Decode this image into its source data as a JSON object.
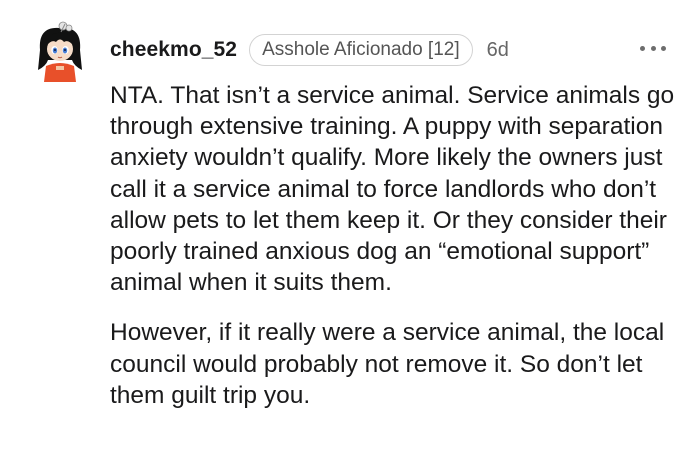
{
  "comment": {
    "username": "cheekmo_52",
    "flair": "Asshole Aficionado [12]",
    "age": "6d",
    "paragraphs": [
      "NTA. That isn’t a service animal. Service animals go through extensive training. A puppy with separation anxiety wouldn’t qualify. More likely the owners just call it a service animal to force landlords who don’t allow pets to let them keep it. Or they consider their poorly trained anxious dog an “emotional support” animal when it suits them.",
      "However, if it really were a service animal, the local council would probably not remove it. So don’t let them guilt trip you."
    ]
  },
  "icons": {
    "avatar": "anime-avatar-icon",
    "more": "more-options-icon"
  },
  "colors": {
    "text": "#1a1a1b",
    "meta": "#666666",
    "flair_border": "#d3d3d3",
    "avatar_hair": "#111111",
    "avatar_shirt": "#e8502a"
  }
}
